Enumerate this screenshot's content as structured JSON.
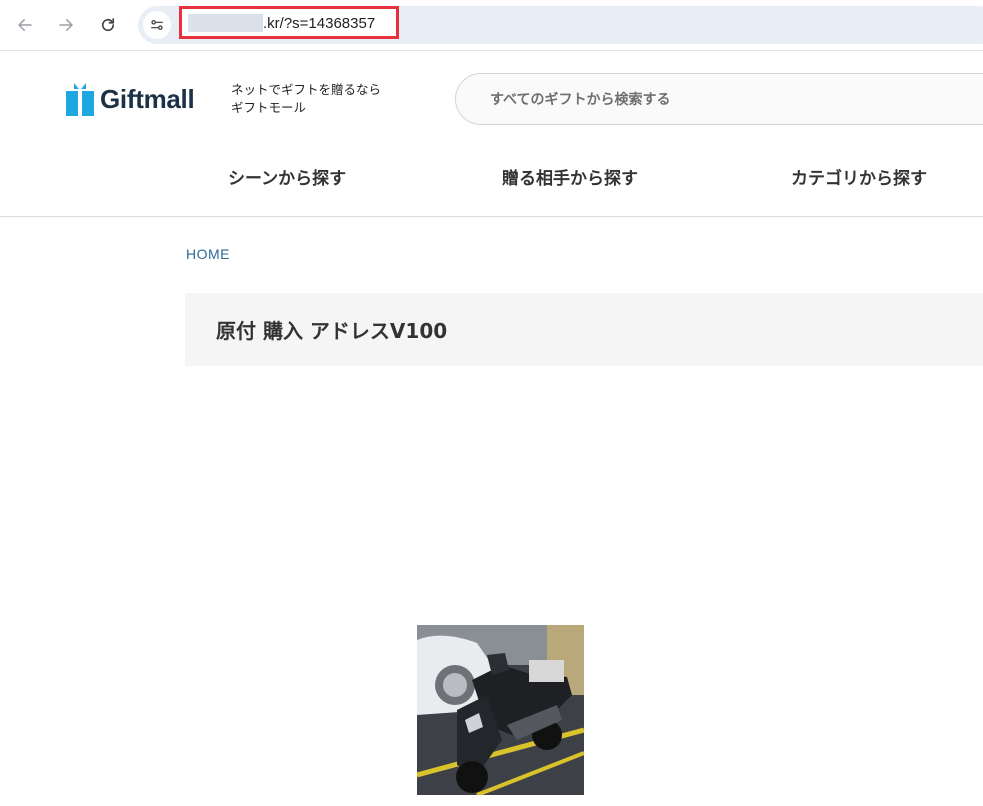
{
  "browser": {
    "url_visible": ".kr/?s=14368357",
    "back_icon": "arrow-left-icon",
    "forward_icon": "arrow-right-icon",
    "reload_icon": "reload-icon",
    "site_info_icon": "tune-icon",
    "highlight_color": "#e8323b"
  },
  "header": {
    "logo_text": "Giftmall",
    "tagline_line1": "ネットでギフトを贈るなら",
    "tagline_line2": "ギフトモール",
    "search_placeholder": "すべてのギフトから検索する",
    "brand_color": "#1b3147",
    "logo_accent": "#1ea7e1"
  },
  "nav": {
    "items": [
      {
        "label": "シーンから探す"
      },
      {
        "label": "贈る相手から探す"
      },
      {
        "label": "カテゴリから探す"
      }
    ]
  },
  "breadcrumb": {
    "home": "HOME"
  },
  "page": {
    "title": "原付 購入 アドレスV100"
  }
}
